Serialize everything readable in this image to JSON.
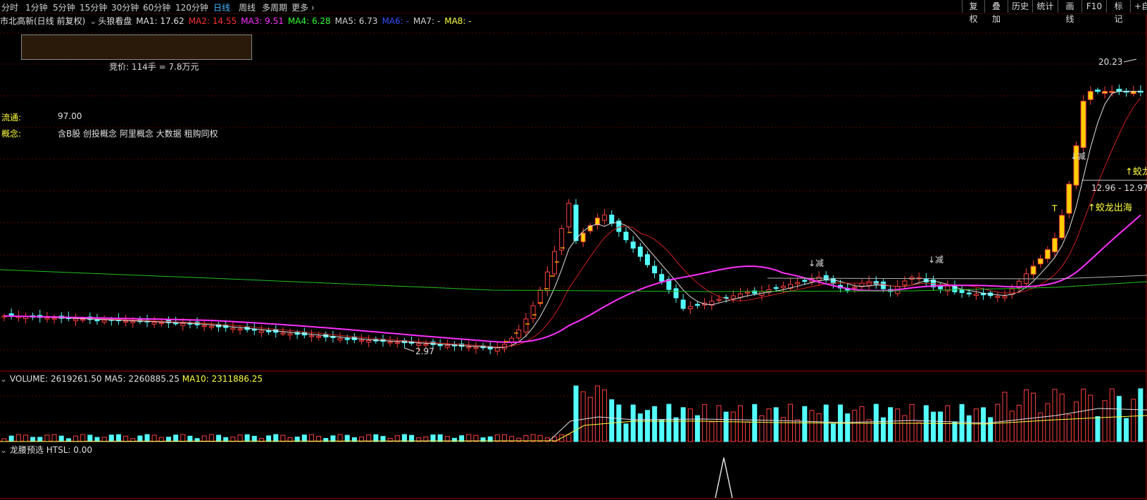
{
  "toolbar": {
    "periods": [
      "分时",
      "1分钟",
      "5分钟",
      "15分钟",
      "30分钟",
      "60分钟",
      "120分钟",
      "日线",
      "周线",
      "多周期",
      "更多"
    ],
    "active_period": "日线",
    "right_buttons": [
      "复权",
      "叠加",
      "历史",
      "统计",
      "画线",
      "F10",
      "标记",
      "+自"
    ]
  },
  "stock": {
    "name": "市北高新(日线 前复权)",
    "indicator_name": "头狼看盘"
  },
  "ma_legend": [
    {
      "label": "MA1: 17.62",
      "color": "#e0e0e0"
    },
    {
      "label": "MA2: 14.55",
      "color": "#ff3030"
    },
    {
      "label": "MA3: 9.51",
      "color": "#ff30ff"
    },
    {
      "label": "MA4: 6.28",
      "color": "#30ff30"
    },
    {
      "label": "MA5: 6.73",
      "color": "#d0d0d0"
    },
    {
      "label": "MA6: -",
      "color": "#3050ff"
    },
    {
      "label": "MA7: -",
      "color": "#d0d0d0"
    },
    {
      "label": "MA8: -",
      "color": "#ffff40"
    }
  ],
  "info": {
    "bid_text": "竞价: 114手 = 7.8万元",
    "float_label": "流通:",
    "float_value": "97.00",
    "concept_label": "概念:",
    "concept_value": "含B股 创投概念 阿里概念 大数据 租购同权"
  },
  "annotations": {
    "high_price": "20.23",
    "low_price": "2.97",
    "range_text": "12.96 - 12.97",
    "dragon1": "↑蛟龙出海",
    "dragon2": "↑蛟龙出",
    "reduce1": "↓减",
    "reduce2": "↓减",
    "reduce3": "↓减",
    "t_mark": "T"
  },
  "volume": {
    "label": "VOLUME: 2619261.50",
    "ma5": "MA5: 2260885.25",
    "ma10": "MA10: 2311886.25"
  },
  "indicator2": {
    "label": "龙腰预选",
    "value": "HTSL: 0.00"
  },
  "colors": {
    "up": "#ff4040",
    "down": "#54ffff",
    "yellow_bar": "#ffd000",
    "ma1": "#e0e0e0",
    "ma2": "#d02020",
    "ma3": "#ff30ff",
    "ma4": "#20c020",
    "ma5": "#b0b0b0"
  }
}
